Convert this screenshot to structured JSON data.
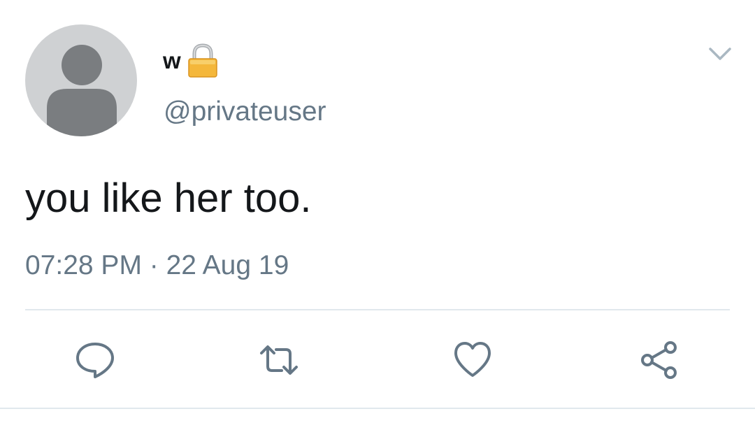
{
  "tweet": {
    "author": {
      "display_name": "w",
      "handle": "@privateuser",
      "protected": true
    },
    "text": "you like her too.",
    "timestamp": "07:28 PM · 22 Aug 19",
    "actions": {
      "reply": "reply-icon",
      "retweet": "retweet-icon",
      "like": "heart-icon",
      "share": "share-icon"
    }
  },
  "colors": {
    "text_primary": "#14171a",
    "text_secondary": "#657786",
    "divider": "#e1e8ed",
    "avatar_bg": "#cfd1d3",
    "avatar_fg": "#7a7d80",
    "icon": "#657786"
  }
}
